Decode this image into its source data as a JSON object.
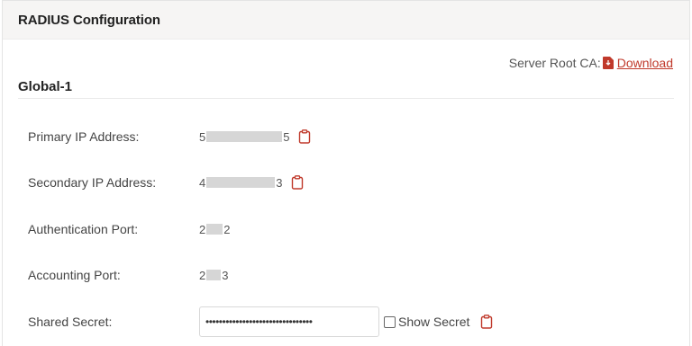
{
  "panel": {
    "title": "RADIUS Configuration"
  },
  "ca": {
    "label": "Server Root CA:",
    "download_label": "Download"
  },
  "group": {
    "title": "Global-1"
  },
  "fields": {
    "primary_ip": {
      "label": "Primary IP Address:",
      "prefix": "5",
      "suffix": "5"
    },
    "secondary_ip": {
      "label": "Secondary IP Address:",
      "prefix": "4",
      "suffix": "3"
    },
    "auth_port": {
      "label": "Authentication Port:",
      "prefix": "2",
      "suffix": "2"
    },
    "acct_port": {
      "label": "Accounting Port:",
      "prefix": "2",
      "suffix": "3"
    },
    "shared_secret": {
      "label": "Shared Secret:",
      "value": "••••••••••••••••••••••••••••••••",
      "show_label": "Show Secret",
      "show_checked": false
    }
  },
  "colors": {
    "accent": "#c0392b",
    "header_bg": "#f6f5f4"
  },
  "icons": {
    "pdf": "file-pdf-icon",
    "copy": "clipboard-icon"
  }
}
